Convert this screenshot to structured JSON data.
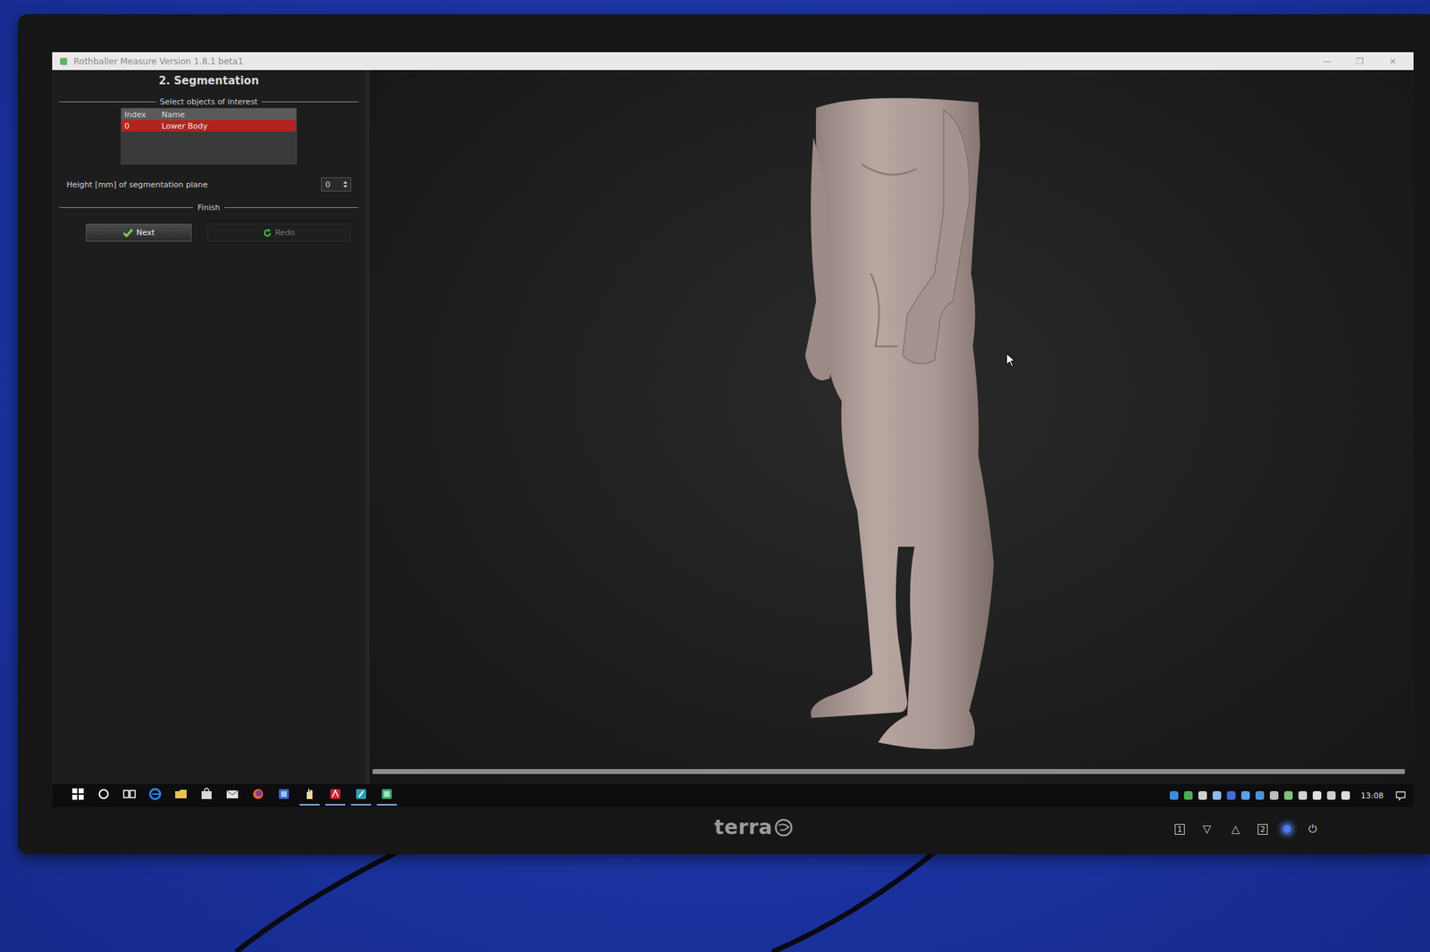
{
  "window": {
    "title": "Rothballer Measure Version 1.8.1 beta1",
    "controls": [
      "—",
      "❐",
      "✕"
    ]
  },
  "panel": {
    "heading": "2. Segmentation",
    "objects_section": "Select objects of interest",
    "table": {
      "columns": [
        "Index",
        "Name"
      ],
      "rows": [
        {
          "cells": [
            "0",
            "Lower Body"
          ],
          "selected": true
        }
      ]
    },
    "height_label": "Height [mm] of segmentation plane",
    "height_value": "0",
    "finish_section": "Finish",
    "buttons": [
      {
        "label": "Next",
        "kind": "next",
        "disabled": false
      },
      {
        "label": "Redo",
        "kind": "redo",
        "disabled": true
      }
    ]
  },
  "viewport": {
    "progress": {
      "level": 1.0
    }
  },
  "taskbar": {
    "apps": [
      {
        "kind": "start",
        "running": false
      },
      {
        "kind": "search",
        "running": false
      },
      {
        "kind": "taskview",
        "running": false
      },
      {
        "kind": "edge",
        "running": false
      },
      {
        "kind": "folder",
        "running": false
      },
      {
        "kind": "store",
        "running": false
      },
      {
        "kind": "mail",
        "running": false
      },
      {
        "kind": "firefox",
        "running": false
      },
      {
        "kind": "generic",
        "running": false
      },
      {
        "kind": "hand",
        "running": true
      },
      {
        "kind": "acrobat",
        "running": true
      },
      {
        "kind": "pen",
        "running": true
      },
      {
        "kind": "measure",
        "running": true
      }
    ],
    "tray": [
      {
        "color": "#3a8ee0"
      },
      {
        "color": "#4caf50"
      },
      {
        "color": "#cfcfcf"
      },
      {
        "color": "#8fbbe8"
      },
      {
        "color": "#3d6fd6"
      },
      {
        "color": "#5aa0e8"
      },
      {
        "color": "#4a90d9"
      },
      {
        "color": "#bdbdbd"
      },
      {
        "color": "#7cc27c"
      },
      {
        "color": "#d0d0d0"
      },
      {
        "color": "#e0e0e0"
      },
      {
        "color": "#cfcfcf"
      },
      {
        "color": "#dcdcdc"
      }
    ],
    "clock": "13:08"
  },
  "monitor": {
    "brand": "terra",
    "buttons": [
      "1",
      "▽",
      "△",
      "2",
      "⏻"
    ],
    "power_on": true
  }
}
